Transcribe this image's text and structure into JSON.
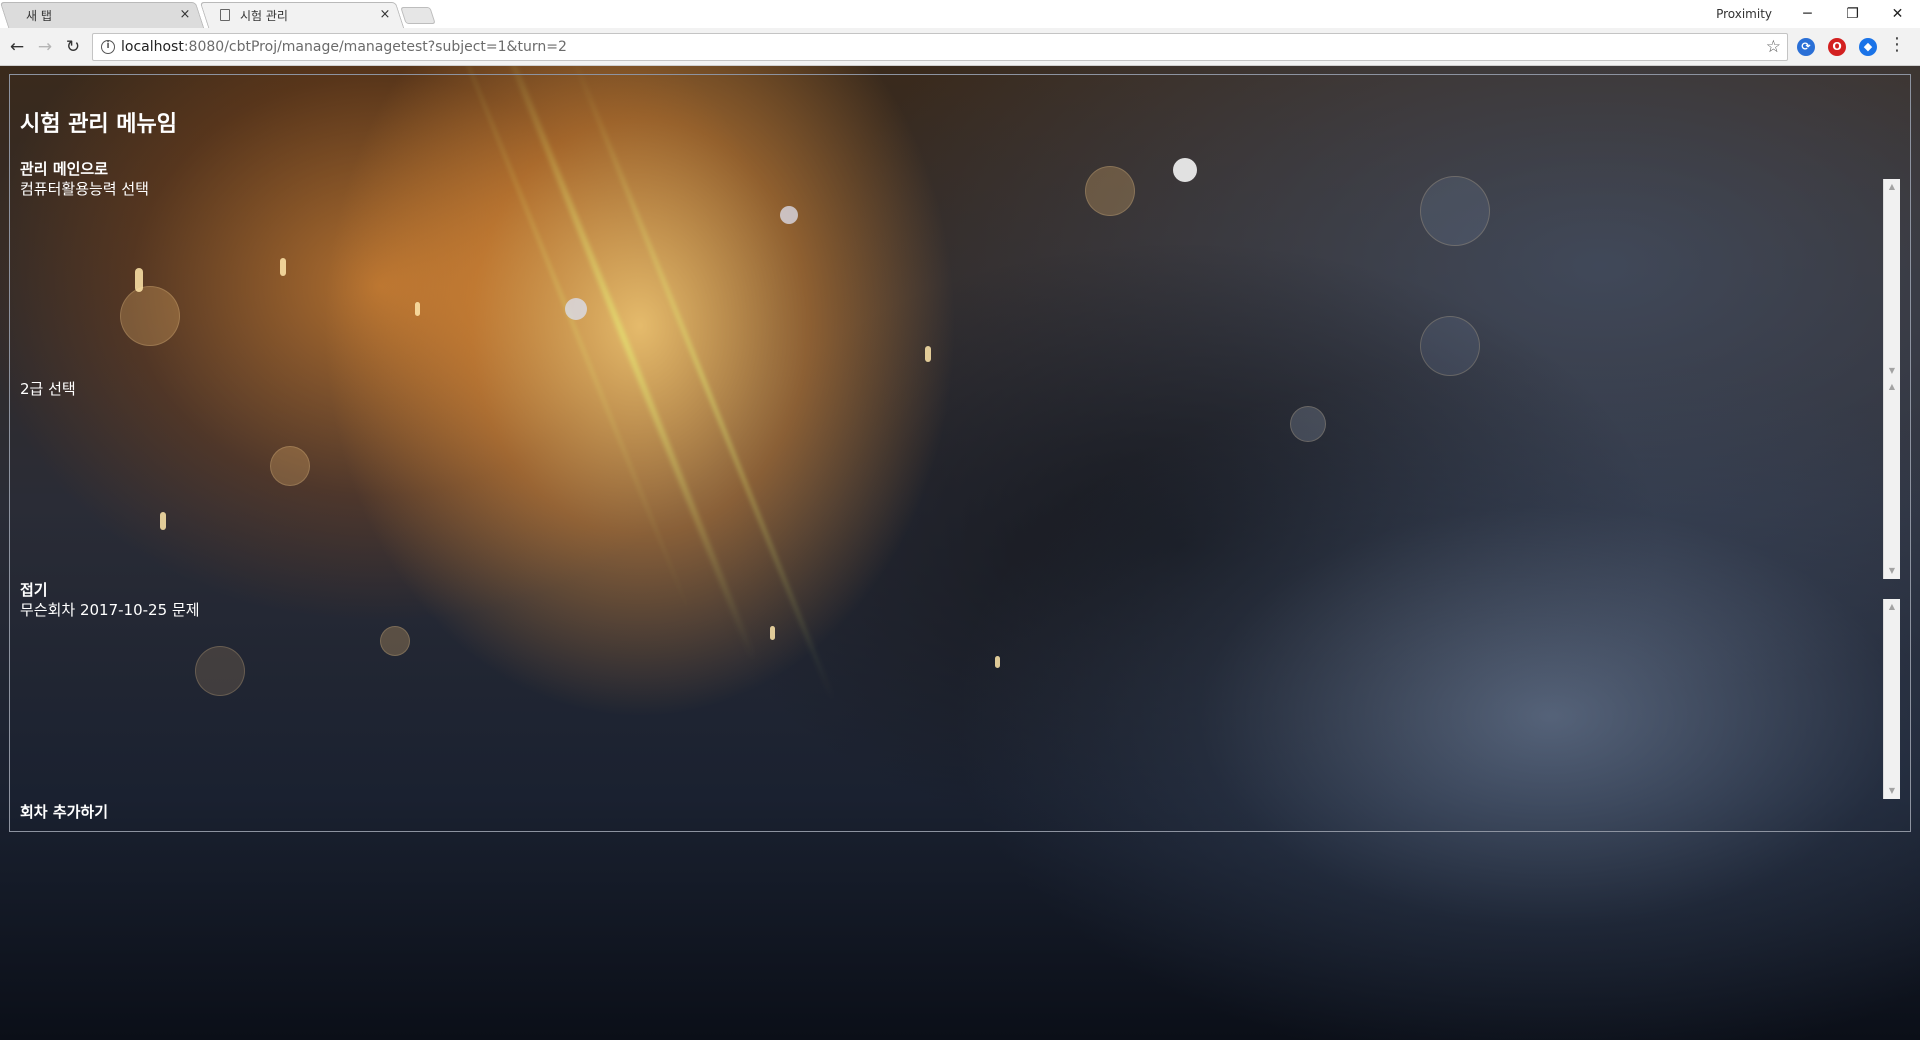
{
  "browser": {
    "tabs": [
      {
        "label": "새 탭",
        "active": false
      },
      {
        "label": "시험 관리",
        "active": true
      }
    ],
    "profile_name": "Proximity",
    "url_host": "localhost",
    "url_rest": ":8080/cbtProj/manage/managetest?subject=1&turn=2",
    "window_controls": {
      "minimize": "─",
      "restore": "❐",
      "close": "✕"
    },
    "icons": {
      "back": "arrow-left-icon",
      "forward": "arrow-right-icon",
      "reload": "reload-icon",
      "info": "info-icon",
      "bookmark": "star-icon",
      "menu": "three-dots-icon"
    }
  },
  "page": {
    "title": "시험 관리 메뉴임",
    "nav_main": "관리 메인으로",
    "subject_select": "컴퓨터활용능력 선택",
    "grade_select": "2급 선택",
    "collapse": "접기",
    "turn_item": "무슨회차 2017-10-25 문제",
    "add_turn": "회차 추가하기"
  },
  "colors": {
    "text": "#ffffff",
    "frame_border": "#8d93a0",
    "chrome_bg": "#f2f2f2"
  }
}
